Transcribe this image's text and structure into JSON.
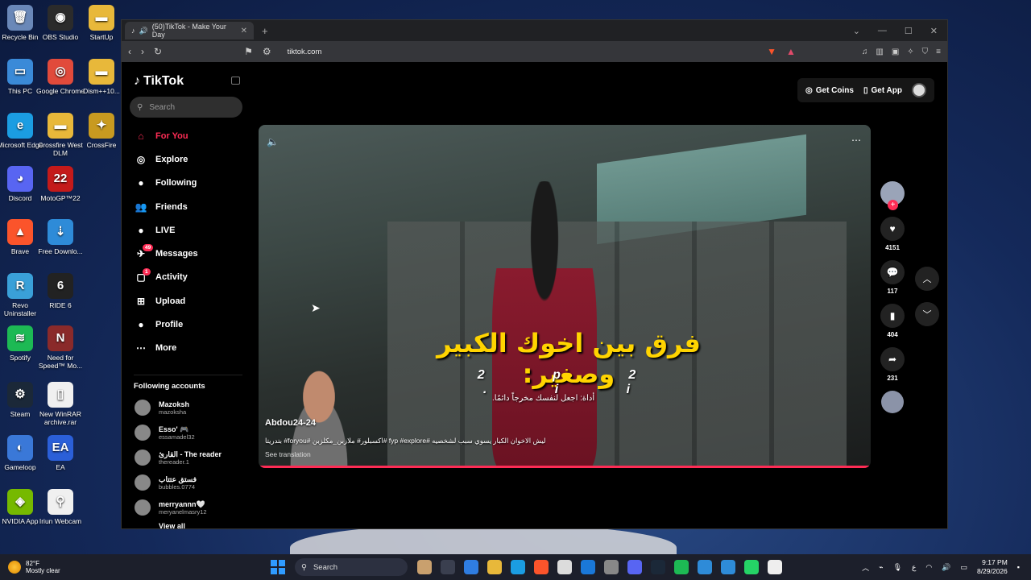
{
  "desktop": {
    "icons": [
      {
        "label": "Recycle Bin",
        "color": "#6a88b8",
        "glyph": "🗑"
      },
      {
        "label": "OBS Studio",
        "color": "#2b2b2b",
        "glyph": "◉"
      },
      {
        "label": "StartUp",
        "color": "#e8b83a",
        "glyph": "▬"
      },
      {
        "label": "This PC",
        "color": "#3a8ad8",
        "glyph": "▭"
      },
      {
        "label": "Google Chrome",
        "color": "#e14a3b",
        "glyph": "◎"
      },
      {
        "label": "Dism++10...",
        "color": "#e8b83a",
        "glyph": "▬"
      },
      {
        "label": "Microsoft Edge",
        "color": "#1b9de2",
        "glyph": "e"
      },
      {
        "label": "Crossfire West DLM",
        "color": "#e8b83a",
        "glyph": "▬"
      },
      {
        "label": "CrossFire",
        "color": "#c89a20",
        "glyph": "✦"
      },
      {
        "label": "Discord",
        "color": "#5865f2",
        "glyph": "◕"
      },
      {
        "label": "MotoGP™22",
        "color": "#c41a1a",
        "glyph": "22"
      },
      {
        "label": "Brave",
        "color": "#fb542b",
        "glyph": "▲"
      },
      {
        "label": "Free Downlo...",
        "color": "#2e8bd8",
        "glyph": "⇣"
      },
      {
        "label": "Revo Uninstaller",
        "color": "#3aa0d8",
        "glyph": "R"
      },
      {
        "label": "RIDE 6",
        "color": "#222222",
        "glyph": "6"
      },
      {
        "label": "Spotify",
        "color": "#1db954",
        "glyph": "≋"
      },
      {
        "label": "Need for Speed™ Mo...",
        "color": "#8a2a2a",
        "glyph": "N"
      },
      {
        "label": "Steam",
        "color": "#1b2838",
        "glyph": "⚙"
      },
      {
        "label": "New WinRAR archive.rar",
        "color": "#f0f0f0",
        "glyph": "▯"
      },
      {
        "label": "Gameloop",
        "color": "#3a78d8",
        "glyph": "◐"
      },
      {
        "label": "EA",
        "color": "#2b5fd8",
        "glyph": "EA"
      },
      {
        "label": "NVIDIA App",
        "color": "#76b900",
        "glyph": "◈"
      },
      {
        "label": "Iriun Webcam",
        "color": "#f0f0f0",
        "glyph": "⚲"
      }
    ]
  },
  "browser": {
    "tab_title": "(50)TikTok - Make Your Day",
    "url": "tiktok.com",
    "new_tab": "+"
  },
  "tiktok": {
    "logo": "TikTok",
    "search_placeholder": "Search",
    "nav": [
      {
        "label": "For You",
        "icon": "home-icon",
        "glyph": "⌂",
        "active": true
      },
      {
        "label": "Explore",
        "icon": "compass-icon",
        "glyph": "◎"
      },
      {
        "label": "Following",
        "icon": "following-icon",
        "glyph": "●"
      },
      {
        "label": "Friends",
        "icon": "friends-icon",
        "glyph": "👥"
      },
      {
        "label": "LIVE",
        "icon": "live-icon",
        "glyph": "●"
      },
      {
        "label": "Messages",
        "icon": "messages-icon",
        "glyph": "✈",
        "badge": "49"
      },
      {
        "label": "Activity",
        "icon": "activity-icon",
        "glyph": "▢",
        "badge": "1"
      },
      {
        "label": "Upload",
        "icon": "upload-icon",
        "glyph": "⊞"
      },
      {
        "label": "Profile",
        "icon": "profile-icon",
        "glyph": "●"
      },
      {
        "label": "More",
        "icon": "more-icon",
        "glyph": "⋯"
      }
    ],
    "following_title": "Following accounts",
    "accounts": [
      {
        "name": "Mazoksh",
        "handle": "mazoksha"
      },
      {
        "name": "Esso' 🎮",
        "handle": "essamadel32"
      },
      {
        "name": "القارئ - The reader",
        "handle": "thereader.1"
      },
      {
        "name": "فستق عتتاب",
        "handle": "bubbles.0774"
      },
      {
        "name": "merryannn🤍",
        "handle": "meryanelmasry12"
      }
    ],
    "view_all": "View all",
    "get_coins": "Get Coins",
    "get_app": "Get App",
    "video": {
      "caption_arabic": "فرق بين اخوك الكبير وصغير:",
      "caption_sub": "2 p 2 . i i",
      "caption_small": "أداة: اجعل لنفسك مخرجاً دائمًا.",
      "author": "Abdou24-24",
      "description": "بتدريتا #foryou# اكسبلور# ملازبن_مكلزبن# fyp #explore# ليش الاخوان الكبار يسوي سبب لشخصيه",
      "see_translation": "See translation"
    },
    "stats": {
      "likes": "4151",
      "comments": "117",
      "saves": "404",
      "shares": "231"
    }
  },
  "taskbar": {
    "temp": "82°F",
    "weather": "Mostly clear",
    "search": "Search",
    "time": "9:17 PM",
    "date": "8/29/2026"
  },
  "colors": {
    "accent": "#fe2c55",
    "taskbar": "#1c1f2b"
  }
}
